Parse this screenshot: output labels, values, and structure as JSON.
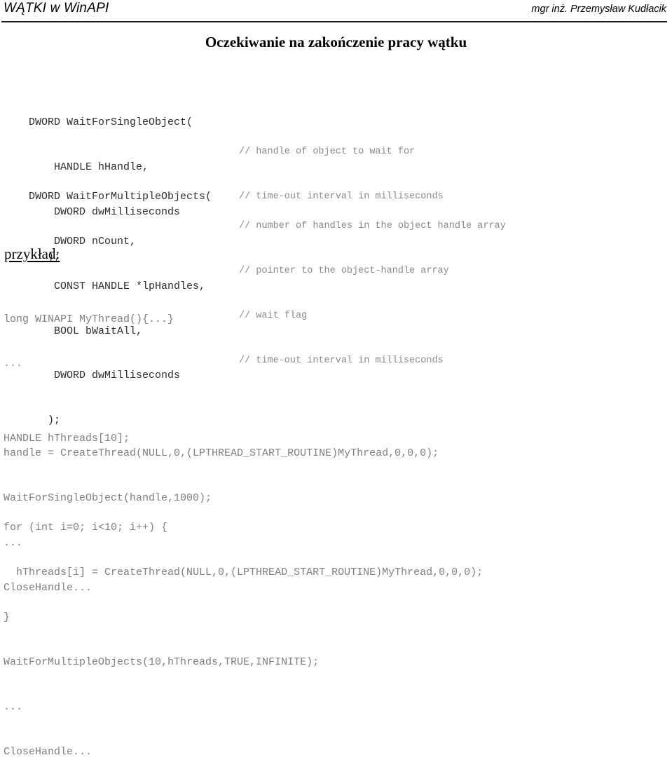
{
  "header": {
    "course_title": "WĄTKI w WinAPI",
    "author": "mgr inż. Przemysław Kudłacik"
  },
  "slide": {
    "title": "Oczekiwanie na zakończenie pracy wątku",
    "example_label": "przykład:"
  },
  "prototype_1": {
    "lines": [
      {
        "code": "DWORD WaitForSingleObject(",
        "comment": ""
      },
      {
        "code": "    HANDLE hHandle,",
        "comment": "// handle of object to wait for"
      },
      {
        "code": "    DWORD dwMilliseconds",
        "comment": "// time-out interval in milliseconds"
      },
      {
        "code": "   );",
        "comment": ""
      }
    ]
  },
  "prototype_2": {
    "lines": [
      {
        "code": "DWORD WaitForMultipleObjects(",
        "comment": ""
      },
      {
        "code": "    DWORD nCount,",
        "comment": "// number of handles in the object handle array"
      },
      {
        "code": "    CONST HANDLE *lpHandles,",
        "comment": "// pointer to the object-handle array"
      },
      {
        "code": "    BOOL bWaitAll,",
        "comment": "// wait flag"
      },
      {
        "code": "    DWORD dwMilliseconds",
        "comment": "// time-out interval in milliseconds"
      },
      {
        "code": "   );",
        "comment": ""
      }
    ]
  },
  "example_1": {
    "lines": [
      "long WINAPI MyThread(){...}",
      "...",
      "",
      "handle = CreateThread(NULL,0,(LPTHREAD_START_ROUTINE)MyThread,0,0,0);",
      "WaitForSingleObject(handle,1000);",
      "...",
      "CloseHandle..."
    ]
  },
  "example_2": {
    "lines": [
      "HANDLE hThreads[10];",
      "",
      "for (int i=0; i<10; i++) {",
      "  hThreads[i] = CreateThread(NULL,0,(LPTHREAD_START_ROUTINE)MyThread,0,0,0);",
      "}",
      "WaitForMultipleObjects(10,hThreads,TRUE,INFINITE);",
      "...",
      "CloseHandle..."
    ]
  },
  "colors": {
    "code_dark": "#2e2e2e",
    "code_gray": "#7f7f7f",
    "comment_gray": "#8a8a8a",
    "rule": "#1a1a1a",
    "background": "#ffffff"
  }
}
